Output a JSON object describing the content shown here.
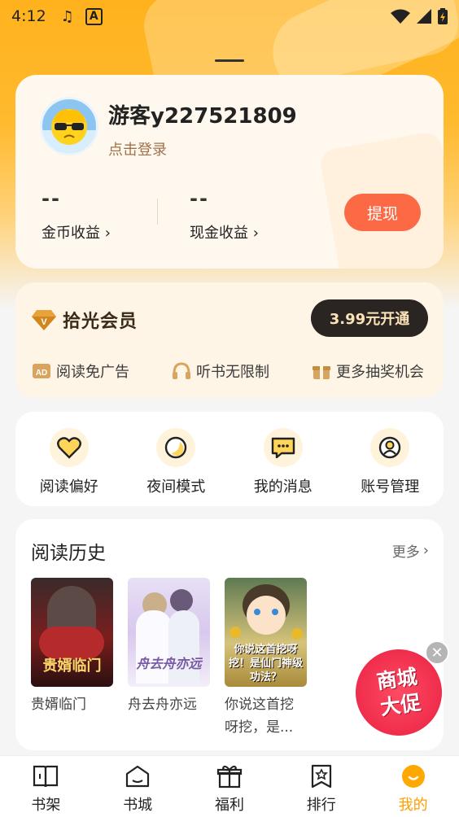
{
  "status_bar": {
    "time": "4:12"
  },
  "profile": {
    "username": "游客y227521809",
    "login_text": "点击登录",
    "coins": {
      "value": "--",
      "label": "金币收益 ›"
    },
    "cash": {
      "value": "--",
      "label": "现金收益 ›"
    },
    "withdraw_label": "提现"
  },
  "vip": {
    "title": "拾光会员",
    "button": "3.99元开通",
    "perks": [
      "阅读免广告",
      "听书无限制",
      "更多抽奖机会"
    ]
  },
  "shortcuts": [
    {
      "label": "阅读偏好",
      "icon": "heart-icon"
    },
    {
      "label": "夜间模式",
      "icon": "moon-icon"
    },
    {
      "label": "我的消息",
      "icon": "message-icon"
    },
    {
      "label": "账号管理",
      "icon": "account-icon"
    }
  ],
  "history": {
    "title": "阅读历史",
    "more": "更多",
    "books": [
      {
        "title": "贵婿临门",
        "cover_text": "贵婿临门"
      },
      {
        "title": "舟去舟亦远",
        "cover_text": "舟去舟亦远"
      },
      {
        "title": "你说这首挖呀挖，是...",
        "cover_text": "你说这首挖呀挖！是仙门神级功法？"
      }
    ]
  },
  "promo": {
    "line1": "商城",
    "line2": "大促"
  },
  "nav": [
    {
      "label": "书架",
      "icon": "bookshelf-icon"
    },
    {
      "label": "书城",
      "icon": "bookstore-icon"
    },
    {
      "label": "福利",
      "icon": "gift-icon"
    },
    {
      "label": "排行",
      "icon": "ranking-icon"
    },
    {
      "label": "我的",
      "icon": "profile-icon",
      "active": true
    }
  ],
  "colors": {
    "accent": "#ff9e00",
    "withdraw": "#fc6a45",
    "vip_button": "#2a2522"
  }
}
